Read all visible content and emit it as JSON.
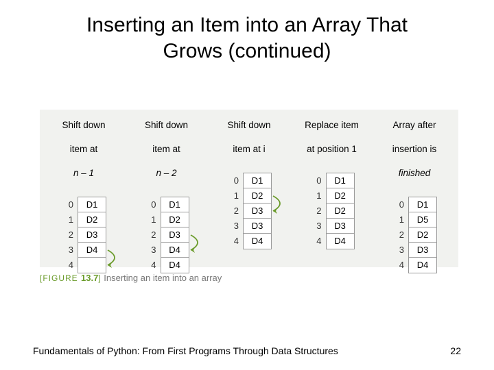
{
  "title_line1": "Inserting an Item into an Array That",
  "title_line2": "Grows (continued)",
  "columns": [
    {
      "head_l1": "Shift down",
      "head_l2": "item at",
      "head_l3": "n – 1",
      "indices": [
        "0",
        "1",
        "2",
        "3",
        "4"
      ],
      "cells": [
        "D1",
        "D2",
        "D3",
        "D4",
        ""
      ],
      "arrow_from": 3,
      "arrow_to": 4
    },
    {
      "head_l1": "Shift down",
      "head_l2": "item at",
      "head_l3": "n – 2",
      "indices": [
        "0",
        "1",
        "2",
        "3",
        "4"
      ],
      "cells": [
        "D1",
        "D2",
        "D3",
        "D4",
        "D4"
      ],
      "arrow_from": 2,
      "arrow_to": 3
    },
    {
      "head_l1": "Shift down",
      "head_l2": "item at i",
      "head_l3": "",
      "indices": [
        "0",
        "1",
        "2",
        "3",
        "4"
      ],
      "cells": [
        "D1",
        "D2",
        "D3",
        "D3",
        "D4"
      ],
      "arrow_from": 1,
      "arrow_to": 2
    },
    {
      "head_l1": "Replace item",
      "head_l2": "at position 1",
      "head_l3": "",
      "indices": [
        "0",
        "1",
        "2",
        "3",
        "4"
      ],
      "cells": [
        "D1",
        "D2",
        "D2",
        "D3",
        "D4"
      ],
      "arrow_from": null,
      "arrow_to": null
    },
    {
      "head_l1": "Array after",
      "head_l2": "insertion is",
      "head_l3": "finished",
      "indices": [
        "0",
        "1",
        "2",
        "3",
        "4"
      ],
      "cells": [
        "D1",
        "D5",
        "D2",
        "D3",
        "D4"
      ],
      "arrow_from": null,
      "arrow_to": null
    }
  ],
  "caption_tag": "[FIGURE ",
  "caption_num": "13.7",
  "caption_close": "]",
  "caption_text": " Inserting an item into an array",
  "footer_left": "Fundamentals of Python: From First Programs Through Data Structures",
  "footer_right": "22"
}
